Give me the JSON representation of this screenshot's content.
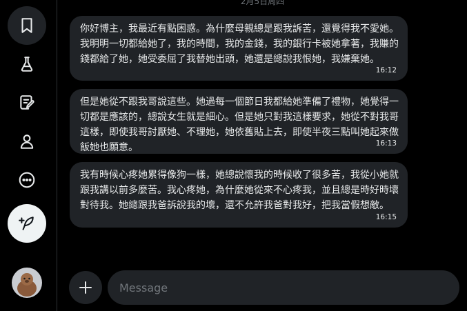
{
  "chat": {
    "date_separator": "2月5日周四",
    "messages": [
      {
        "text": "你好博主，我最近有點困惑。為什麼母親總是跟我訴苦，還覺得我不愛她。我明明一切都給她了，我的時間，我的金錢，我的銀行卡被她拿著，我賺的錢都給了她，她受委屈了我替她出頭，她還是總說我恨她，我嫌棄她。",
        "time": "16:12"
      },
      {
        "text": "但是她從不跟我哥說這些。她過每一個節日我都給她準備了禮物，她覺得一切都是應該的，總說女生就是細心。但是她只對我這樣要求，她從不對我哥這樣，即使我哥討厭她、不理她，她依舊貼上去，即使半夜三點叫她起來做飯她也願意。",
        "time": "16:13"
      },
      {
        "text": "我有時候心疼她累得像狗一樣，她總說懷我的時候收了很多苦，我從小她就跟我講以前多麼苦。我心疼她，為什麼她從來不心疼我，並且總是時好時壞對待我。她總跟我爸訴說我的壞，還不允許我爸對我好，把我當假想敵。",
        "time": "16:15"
      }
    ]
  },
  "composer": {
    "placeholder": "Message"
  },
  "sidebar": {
    "icons": [
      "bookmark-icon",
      "flask-icon",
      "notes-icon",
      "profile-icon",
      "more-icon",
      "compose-icon"
    ]
  },
  "colors": {
    "background": "#000000",
    "bubble": "#202327",
    "text": "#e7e9ea",
    "muted": "#71767b",
    "compose_button": "#eff3f4"
  }
}
